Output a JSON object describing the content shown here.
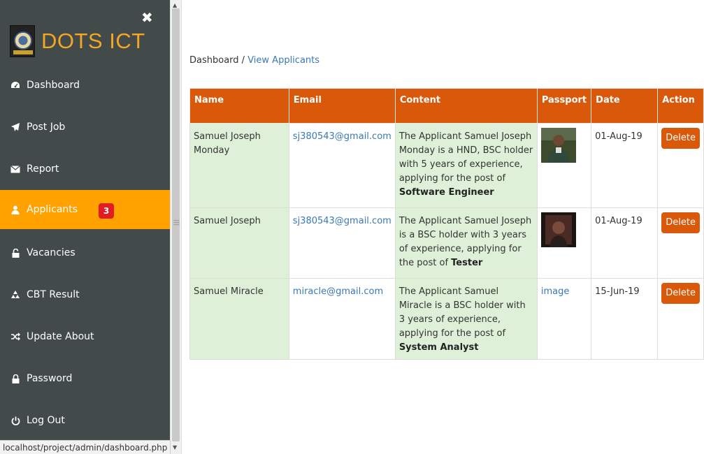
{
  "sidebar": {
    "brand": "DOTS ICT",
    "close_icon": "close-icon",
    "items": [
      {
        "label": "Dashboard",
        "icon": "dashboard-icon"
      },
      {
        "label": "Post Job",
        "icon": "paper-plane-icon"
      },
      {
        "label": "Report",
        "icon": "envelope-icon"
      },
      {
        "label": "Applicants",
        "icon": "user-icon",
        "badge": "3",
        "active": true
      },
      {
        "label": "Vacancies",
        "icon": "unlock-icon"
      },
      {
        "label": "CBT Result",
        "icon": "recycle-icon"
      },
      {
        "label": "Update About",
        "icon": "shuffle-icon"
      },
      {
        "label": "Password",
        "icon": "lock-icon"
      },
      {
        "label": "Log Out",
        "icon": "power-icon"
      }
    ],
    "active_color": "#ffa200",
    "bg_color": "#434a4a"
  },
  "breadcrumb": {
    "home": "Dashboard",
    "separator": " / ",
    "current": "View Applicants"
  },
  "table": {
    "headers": [
      "Name",
      "Email",
      "Content",
      "Passport",
      "Date",
      "Action"
    ],
    "header_color": "#d9580a",
    "rows": [
      {
        "name": "Samuel Joseph Monday",
        "email": "sj380543@gmail.com",
        "content_prefix": "The Applicant Samuel Joseph Monday is a HND, BSC holder with 5 years of experience, applying for the post of ",
        "job": "Software Engineer",
        "passport": "photo",
        "date": "01-Aug-19",
        "action": "Delete"
      },
      {
        "name": "Samuel Joseph",
        "email": "sj380543@gmail.com",
        "content_prefix": "The Applicant Samuel Joseph is a BSC holder with 3 years of experience, applying for the post of ",
        "job": "Tester",
        "passport": "photo",
        "date": "01-Aug-19",
        "action": "Delete"
      },
      {
        "name": "Samuel Miracle",
        "email": "miracle@gmail.com",
        "content_prefix": "The Applicant Samuel Miracle is a BSC holder with 3 years of experience, applying for the post of ",
        "job": "System Analyst",
        "passport_text": "image",
        "date": "15-Jun-19",
        "action": "Delete"
      }
    ]
  },
  "status_url": "localhost/project/admin/dashboard.php"
}
